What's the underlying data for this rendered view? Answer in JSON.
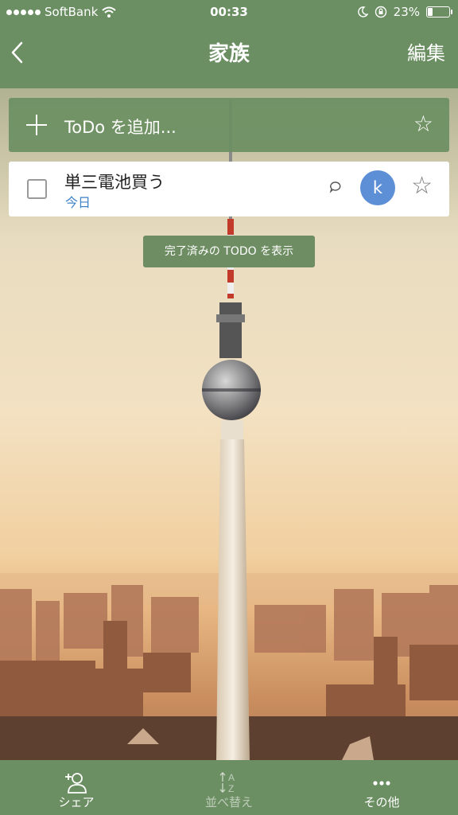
{
  "status_bar": {
    "carrier": "SoftBank",
    "time": "00:33",
    "battery_percent": "23%",
    "battery_level": 0.23,
    "icons": [
      "signal-dots-icon",
      "wifi-icon",
      "moon-icon",
      "rotation-lock-icon",
      "battery-icon"
    ]
  },
  "nav": {
    "back_icon": "chevron-left-icon",
    "title": "家族",
    "edit_label": "編集"
  },
  "add_todo": {
    "placeholder": "ToDo を追加...",
    "plus_icon": "plus-icon",
    "star_icon": "star-outline-icon"
  },
  "tasks": [
    {
      "title": "単三電池買う",
      "due": "今日",
      "avatar_initial": "k",
      "has_comment": true,
      "starred": false
    }
  ],
  "show_completed_label": "完了済みの TODO を表示",
  "toolbar": {
    "share_label": "シェア",
    "sort_label": "並べ替え",
    "more_label": "その他"
  },
  "colors": {
    "accent_green": "#6b8f62",
    "due_blue": "#3d83c7",
    "avatar_blue": "#5c8fd6"
  }
}
